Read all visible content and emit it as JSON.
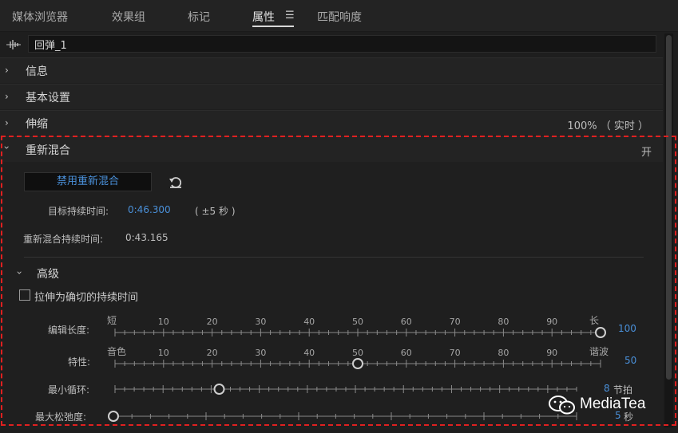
{
  "tabs": [
    {
      "label": "媒体浏览器"
    },
    {
      "label": "效果组"
    },
    {
      "label": "标记"
    },
    {
      "label": "属性"
    },
    {
      "label": "匹配响度"
    }
  ],
  "active_tab": "属性",
  "clip_name": "回弹_1",
  "sections": {
    "info": {
      "label": "信息"
    },
    "basic": {
      "label": "基本设置"
    },
    "stretch": {
      "label": "伸缩",
      "value": "100%",
      "mode": "（ 实时 ）"
    },
    "remix": {
      "label": "重新混合",
      "state": "开"
    }
  },
  "remix": {
    "disable_label": "禁用重新混合",
    "target_label": "目标持续时间:",
    "target_value": "0:46.300",
    "target_tolerance": "( ±5 秒 )",
    "remix_duration_label": "重新混合持续时间:",
    "remix_duration_value": "0:43.165",
    "advanced_label": "高级",
    "stretch_exact_label": "拉伸为确切的持续时间",
    "stretch_exact_checked": false,
    "edit_length": {
      "label": "编辑长度:",
      "min_label": "短",
      "max_label": "长",
      "value": 100,
      "display": "100"
    },
    "character": {
      "label": "特性:",
      "min_label": "音色",
      "max_label": "谐波",
      "value": 50,
      "display": "50"
    },
    "min_loop": {
      "label": "最小循环:",
      "value": 8,
      "min": 1,
      "max": 32,
      "display": "8",
      "unit": "节拍"
    },
    "max_relax": {
      "label": "最大松弛度:",
      "value": 5,
      "min": 5,
      "max": 30,
      "display": "5",
      "unit": "秒"
    },
    "scale_numbers": [
      "10",
      "20",
      "30",
      "40",
      "50",
      "60",
      "70",
      "80",
      "90"
    ]
  },
  "watermark": "MediaTea",
  "colors": {
    "accent": "#4a90d9",
    "annotation": "#e02020",
    "background": "#1e1e1e"
  }
}
